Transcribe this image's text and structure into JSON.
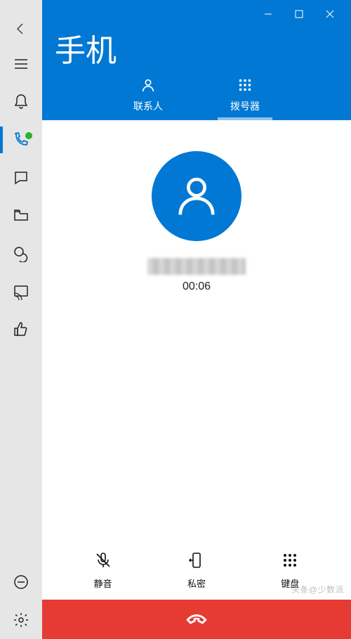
{
  "window": {
    "title": "手机"
  },
  "tabs": {
    "contacts": "联系人",
    "dialer": "拨号器"
  },
  "call": {
    "timer": "00:06"
  },
  "actions": {
    "mute": "静音",
    "private": "私密",
    "keypad": "键盘"
  },
  "watermark": "头条@少数派"
}
